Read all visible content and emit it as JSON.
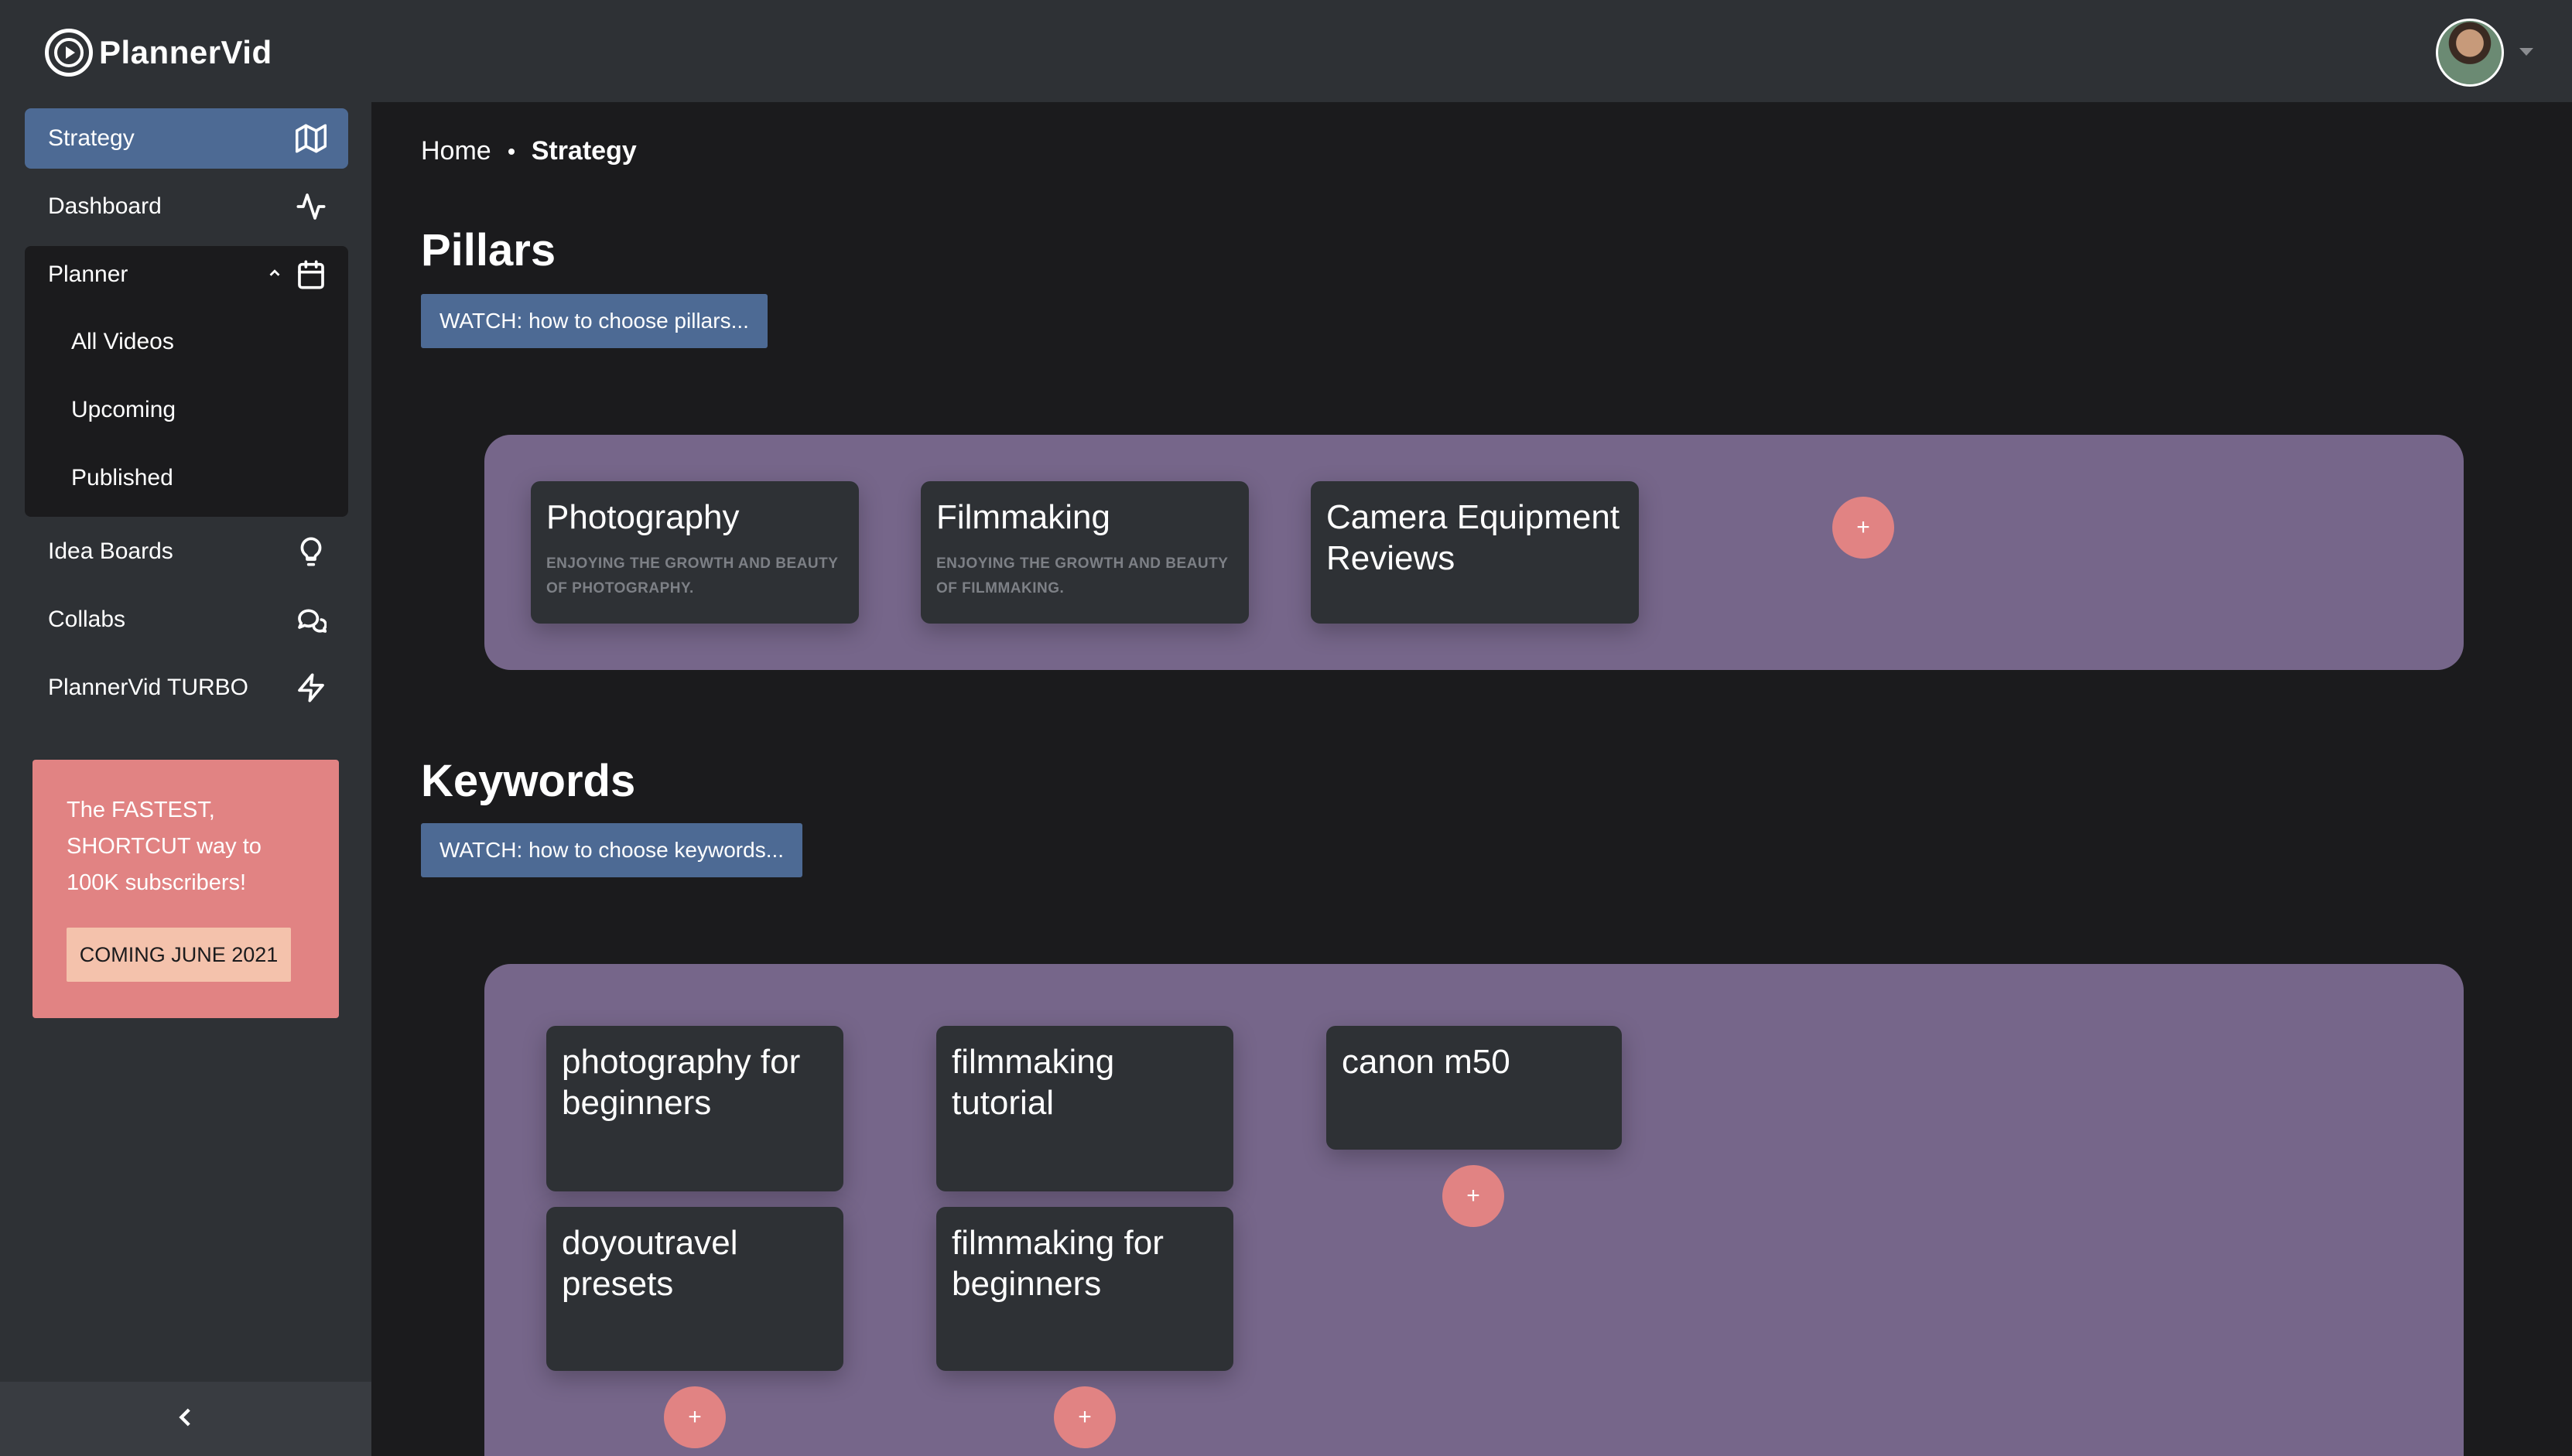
{
  "app": {
    "name": "PlannerVid"
  },
  "sidebar": {
    "items": [
      {
        "label": "Strategy",
        "icon": "map-icon"
      },
      {
        "label": "Dashboard",
        "icon": "activity-icon"
      },
      {
        "label": "Planner",
        "icon": "calendar-icon",
        "expanded": true
      },
      {
        "label": "Idea Boards",
        "icon": "lightbulb-icon"
      },
      {
        "label": "Collabs",
        "icon": "chat-bubbles-icon"
      },
      {
        "label": "PlannerVid TURBO",
        "icon": "lightning-icon"
      }
    ],
    "planner_sub": [
      "All Videos",
      "Upcoming",
      "Published"
    ],
    "promo": {
      "text": "The FASTEST, SHORTCUT way to 100K subscribers!",
      "button": "COMING JUNE 2021"
    },
    "accent": "#4d6a94"
  },
  "breadcrumb": {
    "home": "Home",
    "current": "Strategy"
  },
  "pillars": {
    "title": "Pillars",
    "watch_label": "WATCH: how to choose pillars...",
    "cards": [
      {
        "title": "Photography",
        "desc": "ENJOYING THE GROWTH AND BEAUTY OF PHOTOGRAPHY."
      },
      {
        "title": "Filmmaking",
        "desc": "ENJOYING THE GROWTH AND BEAUTY OF FILMMAKING."
      },
      {
        "title": "Camera Equipment Reviews",
        "desc": ""
      }
    ],
    "add_label": "+"
  },
  "keywords": {
    "title": "Keywords",
    "watch_label": "WATCH: how to choose keywords...",
    "columns": [
      [
        "photography for beginners",
        "doyoutravel presets"
      ],
      [
        "filmmaking tutorial",
        "filmmaking for beginners"
      ],
      [
        "canon m50"
      ]
    ],
    "add_label": "+"
  },
  "colors": {
    "board": "#76668a",
    "card": "#2e3135",
    "plus": "#e18383",
    "promo": "#e18383"
  }
}
